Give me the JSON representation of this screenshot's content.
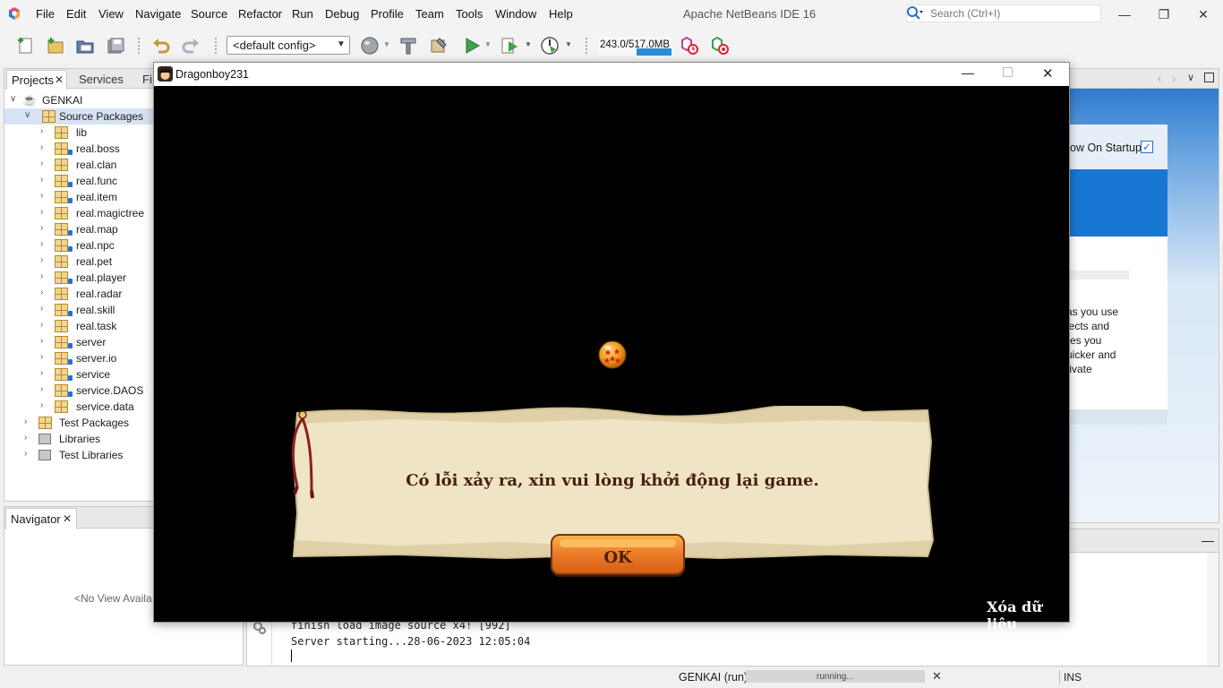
{
  "menu": [
    "File",
    "Edit",
    "View",
    "Navigate",
    "Source",
    "Refactor",
    "Run",
    "Debug",
    "Profile",
    "Team",
    "Tools",
    "Window",
    "Help"
  ],
  "ide_title": "Apache NetBeans IDE 16",
  "search": {
    "placeholder": "Search (Ctrl+I)"
  },
  "toolbar": {
    "config": "<default config>",
    "memory": "243.0/517.0MB",
    "memory_used_fraction": 0.47
  },
  "projects_panel": {
    "tabs": [
      "Projects",
      "Services",
      "Fi"
    ],
    "project_name": "GENKAI",
    "source_packages": "Source Packages",
    "packages": [
      "lib",
      "real.boss",
      "real.clan",
      "real.func",
      "real.item",
      "real.magictree",
      "real.map",
      "real.npc",
      "real.pet",
      "real.player",
      "real.radar",
      "real.skill",
      "real.task",
      "server",
      "server.io",
      "service",
      "service.DAOS",
      "service.data"
    ],
    "other_nodes": [
      "Test Packages",
      "Libraries",
      "Test Libraries"
    ]
  },
  "navigator": {
    "title": "Navigator",
    "empty_text": "<No View Availa"
  },
  "start_page": {
    "show_on_startup": "ow On Startup",
    "text_lines": [
      "as you use",
      "jects and",
      "res you",
      "uicker and",
      "tivate"
    ]
  },
  "output": {
    "lines": [
      "finish load image source x4! [992]",
      "Server starting...28-06-2023 12:05:04"
    ]
  },
  "status_bar": {
    "task": "GENKAI (run)",
    "progress_text": "running...",
    "mode": "INS"
  },
  "game": {
    "window_title": "Dragonboy231",
    "dialog_message": "Có lỗi xảy ra, xin vui lòng khởi động lại game.",
    "ok_label": "OK",
    "clear_data": "Xóa dữ liệu"
  }
}
